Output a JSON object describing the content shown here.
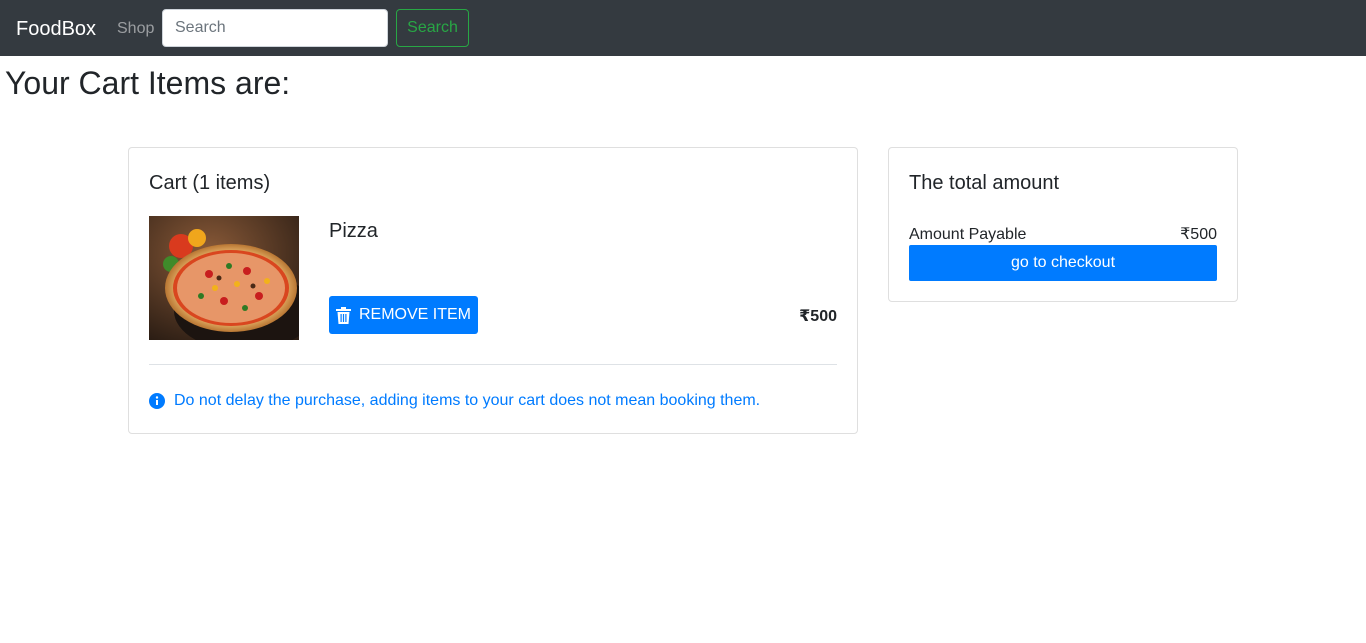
{
  "navbar": {
    "brand": "FoodBox",
    "shop_link": "Shop",
    "search_placeholder": "Search",
    "search_button": "Search"
  },
  "page": {
    "heading": "Your Cart Items are:"
  },
  "cart": {
    "title": "Cart (1 items)",
    "items": [
      {
        "name": "Pizza",
        "image_icon": "pizza-image",
        "remove_label": "REMOVE ITEM",
        "price": "₹500"
      }
    ],
    "notice": "Do not delay the purchase, adding items to your cart does not mean booking them."
  },
  "summary": {
    "title": "The total amount",
    "amount_label": "Amount Payable",
    "amount_value": "₹500",
    "checkout_label": "go to checkout"
  },
  "colors": {
    "navbar_bg": "#343a40",
    "primary": "#007bff",
    "success": "#28a745"
  }
}
